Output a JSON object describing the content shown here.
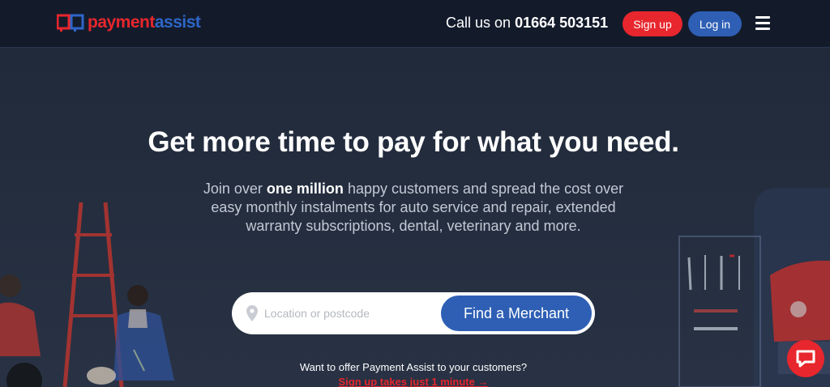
{
  "header": {
    "logo": {
      "part1": "payment",
      "part2": "assist",
      "icon": "payment-assist-logo-icon"
    },
    "call_prefix": "Call us on",
    "phone": "01664 503151",
    "signup_label": "Sign up",
    "login_label": "Log in",
    "menu_icon": "hamburger-menu-icon"
  },
  "hero": {
    "headline": "Get more time to pay for what you need.",
    "sub_prefix": "Join over",
    "sub_bold": "one million",
    "sub_suffix": "happy customers and spread the cost over easy monthly instalments for auto service and repair, extended warranty subscriptions, dental, veterinary and more."
  },
  "search": {
    "placeholder": "Location or postcode",
    "value": "",
    "button_label": "Find a Merchant",
    "icon": "location-pin-icon"
  },
  "offer": {
    "question": "Want to offer Payment Assist to your customers?",
    "link_label": "Sign up takes just 1 minute →"
  },
  "chat": {
    "icon": "chat-bubble-icon"
  },
  "colors": {
    "brand_red": "#e8262d",
    "brand_blue": "#2e5fb5",
    "nav_bg": "#131b2b",
    "hero_bg": "#222c3c"
  }
}
